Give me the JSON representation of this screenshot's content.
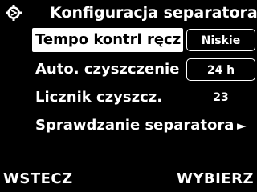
{
  "header": {
    "title": "Konfiguracja separatora",
    "icon": "separator-gear-icon"
  },
  "menu": {
    "items": [
      {
        "label": "Tempo kontrl ręcz",
        "value": "Niskie"
      },
      {
        "label": "Auto. czyszczenie",
        "value": "24 h"
      },
      {
        "label": "Licznik czyszcz.",
        "value": "23"
      },
      {
        "label": "Sprawdzanie separatora",
        "arrow": "►"
      }
    ]
  },
  "softkeys": {
    "left": "WSTECZ",
    "right": "WYBIERZ"
  },
  "colors": {
    "background": "#000000",
    "foreground": "#ffffff",
    "selection": "#ffffff"
  }
}
